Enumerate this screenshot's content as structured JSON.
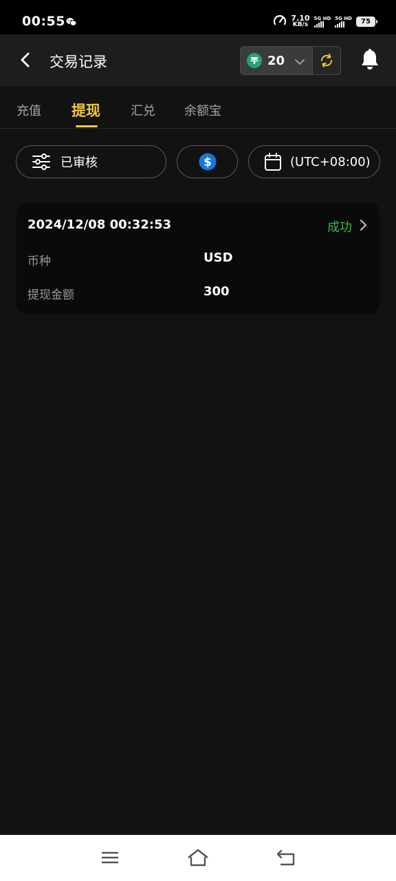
{
  "status_bar": {
    "time": "00:55",
    "net_speed_value": "7.10",
    "net_speed_unit": "KB/s",
    "sim1": "5G HD",
    "sim2": "5G HD",
    "battery": "75"
  },
  "header": {
    "title": "交易记录",
    "balance": "20",
    "coin_icon": "usdt-icon"
  },
  "tabs": [
    {
      "label": "充值",
      "active": false
    },
    {
      "label": "提现",
      "active": true
    },
    {
      "label": "汇兑",
      "active": false
    },
    {
      "label": "余额宝",
      "active": false
    }
  ],
  "filters": {
    "status": "已审核",
    "currency_icon": "dollar-icon",
    "timezone": "(UTC+08:00)"
  },
  "records": [
    {
      "datetime": "2024/12/08 00:32:53",
      "status": "成功",
      "currency_label": "币种",
      "currency_value": "USD",
      "amount_label": "提现金额",
      "amount_value": "300"
    }
  ],
  "colors": {
    "accent": "#f0c93a",
    "success": "#3db34a",
    "background": "#121212",
    "card": "#0a0a0a"
  }
}
